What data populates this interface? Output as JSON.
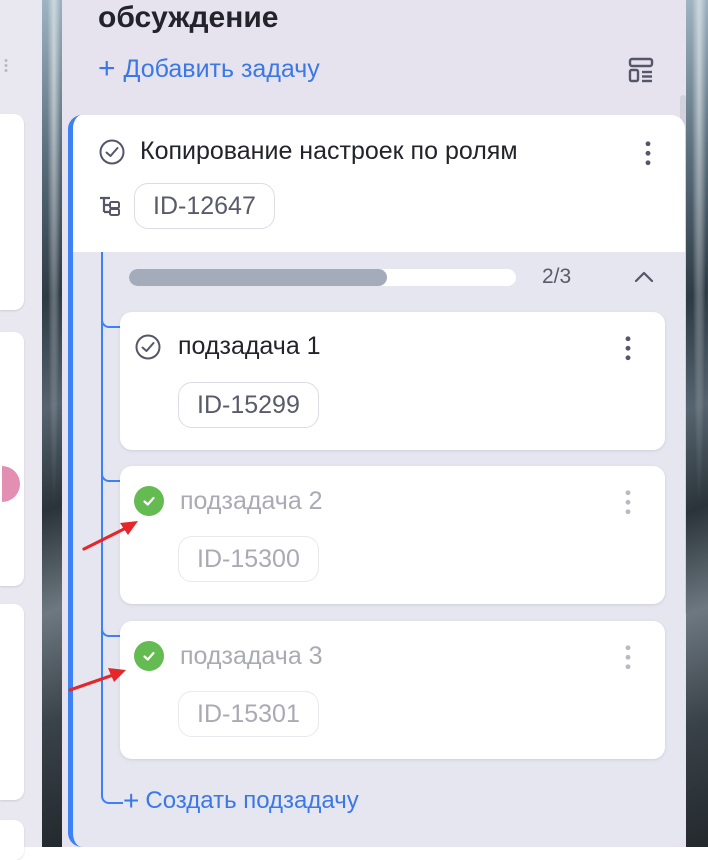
{
  "column": {
    "title": "обсуждение",
    "add_task_label": "Добавить задачу",
    "add_task_icon": "plus-icon",
    "template_icon": "task-template-icon"
  },
  "parent_task": {
    "title": "Копирование настроек по ролям",
    "id": "ID-12647",
    "status_icon": "check-circle-outline-icon",
    "type_icon": "subtasks-tree-icon",
    "accent": "#3c82f6"
  },
  "subtasks_progress": {
    "label": "2/3",
    "done": 2,
    "total": 3,
    "fraction": 0.667
  },
  "subtasks": [
    {
      "title": "подзадача 1",
      "id": "ID-15299",
      "completed": false,
      "status_icon": "check-circle-outline-icon"
    },
    {
      "title": "подзадача 2",
      "id": "ID-15300",
      "completed": true,
      "status_icon": "check-circle-filled-icon"
    },
    {
      "title": "подзадача 3",
      "id": "ID-15301",
      "completed": true,
      "status_icon": "check-circle-filled-icon"
    }
  ],
  "create_subtask_label": "Создать подзадачу",
  "colors": {
    "link": "#3a78e6",
    "done_green": "#64bb52",
    "annotation_arrow": "#e5262a"
  }
}
